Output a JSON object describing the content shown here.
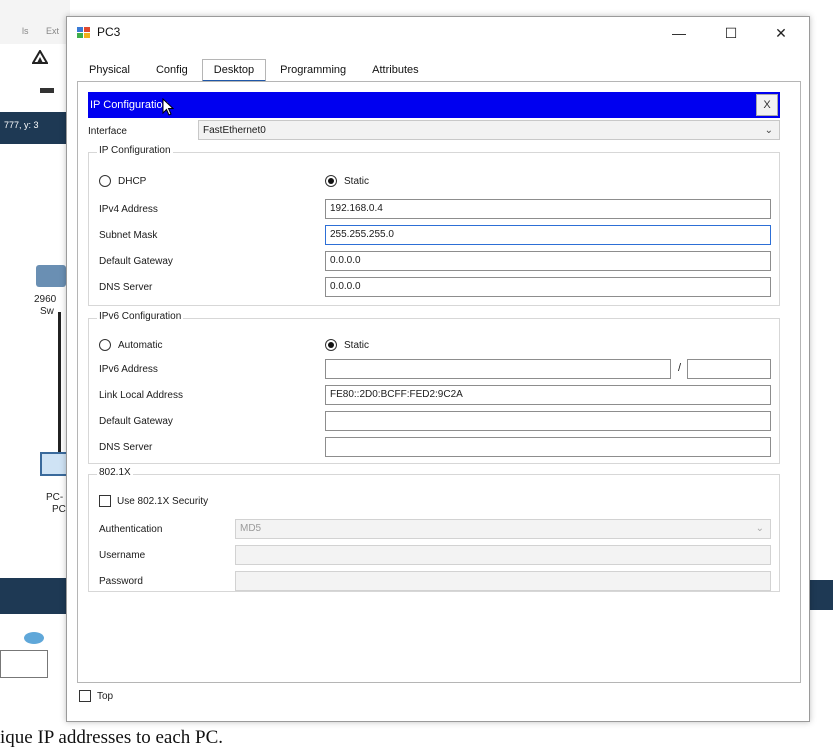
{
  "background": {
    "menu_items": [
      "ls",
      "Ext"
    ],
    "coords_text": "777, y: 3",
    "switch_label_1": "2960",
    "switch_label_2": "Sw",
    "pc_label_1": "PC-",
    "pc_label_2": "PC",
    "caption": "ique IP addresses to each PC."
  },
  "window": {
    "title": "PC3",
    "minimize": "—",
    "maximize": "☐",
    "close": "✕"
  },
  "tabs": [
    {
      "label": "Physical",
      "active": false
    },
    {
      "label": "Config",
      "active": false
    },
    {
      "label": "Desktop",
      "active": true
    },
    {
      "label": "Programming",
      "active": false
    },
    {
      "label": "Attributes",
      "active": false
    }
  ],
  "ip_config": {
    "bar_title": "IP Configuration",
    "close_label": "X",
    "interface_label": "Interface",
    "interface_value": "FastEthernet0",
    "ipv4": {
      "group_title": "IP Configuration",
      "dhcp_label": "DHCP",
      "static_label": "Static",
      "address_label": "IPv4 Address",
      "address_value": "192.168.0.4",
      "mask_label": "Subnet Mask",
      "mask_value": "255.255.255.0",
      "gateway_label": "Default Gateway",
      "gateway_value": "0.0.0.0",
      "dns_label": "DNS Server",
      "dns_value": "0.0.0.0"
    },
    "ipv6": {
      "group_title": "IPv6 Configuration",
      "auto_label": "Automatic",
      "static_label": "Static",
      "address_label": "IPv6 Address",
      "address_value": "",
      "prefix_sep": "/",
      "prefix_value": "",
      "link_local_label": "Link Local Address",
      "link_local_value": "FE80::2D0:BCFF:FED2:9C2A",
      "gateway_label": "Default Gateway",
      "gateway_value": "",
      "dns_label": "DNS Server",
      "dns_value": ""
    },
    "dot1x": {
      "group_title": "802.1X",
      "use_label": "Use 802.1X Security",
      "auth_label": "Authentication",
      "auth_value": "MD5",
      "username_label": "Username",
      "username_value": "",
      "password_label": "Password",
      "password_value": ""
    }
  },
  "footer": {
    "top_label": "Top"
  },
  "colors": {
    "title_bar": "#0000f0",
    "tab_accent": "#1f57a8"
  }
}
